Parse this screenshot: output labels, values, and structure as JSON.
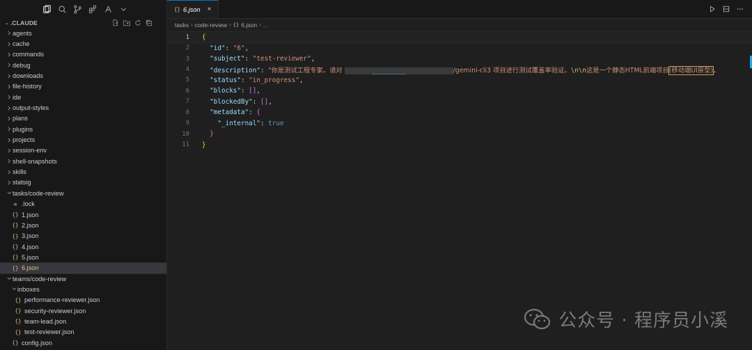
{
  "sidebar": {
    "title": ".CLAUDE",
    "folders": [
      "agents",
      "cache",
      "commands",
      "debug",
      "downloads",
      "file-history",
      "ide",
      "output-styles",
      "plans",
      "plugins",
      "projects",
      "session-env",
      "shell-snapshots",
      "skills",
      "statsig"
    ],
    "tasks_folder": {
      "label": "tasks/code-review",
      "files": [
        ".lock",
        "1.json",
        "2.json",
        "3.json",
        "4.json",
        "5.json",
        "6.json"
      ]
    },
    "teams_folder": {
      "label": "teams/code-review",
      "inboxes_label": "inboxes",
      "inbox_files": [
        "performance-reviewer.json",
        "security-reviewer.json",
        "team-lead.json",
        "test-reviewer.json"
      ],
      "files": [
        "config.json"
      ]
    }
  },
  "editor": {
    "tab": {
      "label": "6.json",
      "icon": "json-braces-icon",
      "close": "×"
    },
    "breadcrumb": {
      "part1": "tasks",
      "part2": "code-review",
      "part3": "6.json",
      "part4": "..."
    },
    "current_line": 1,
    "line_numbers": [
      "1",
      "2",
      "3",
      "4",
      "5",
      "6",
      "7",
      "8",
      "9",
      "10",
      "11"
    ],
    "code": {
      "open_brace": "{",
      "id_key": "\"id\"",
      "id_val": "\"6\"",
      "subject_key": "\"subject\"",
      "subject_val": "\"test-reviewer\"",
      "description_key": "\"description\"",
      "description_part1": "\"你是测试工程专家。请对 ",
      "description_part2": "/gemini-cli3 项目进行测试覆盖率验证。",
      "description_escape": "\\n\\n",
      "description_part3": "这是一个静态HTML前端项目",
      "description_part4": "(移动端UI原型)",
      "description_part5": "，",
      "status_key": "\"status\"",
      "status_val": "\"in_progress\"",
      "blocks_key": "\"blocks\"",
      "blocks_val": "[]",
      "blockedby_key": "\"blockedBy\"",
      "blockedby_val": "[]",
      "metadata_key": "\"metadata\"",
      "internal_key": "\"_internal\"",
      "internal_val": "true",
      "close_meta": "}",
      "close_brace": "}"
    }
  },
  "watermark": {
    "text": "公众号 · 程序员小溪"
  },
  "colors": {
    "accent": "#0078d4",
    "json_icon": "#e2c08d",
    "key": "#9cdcfe",
    "string": "#ce9178",
    "literal": "#569cd6"
  }
}
